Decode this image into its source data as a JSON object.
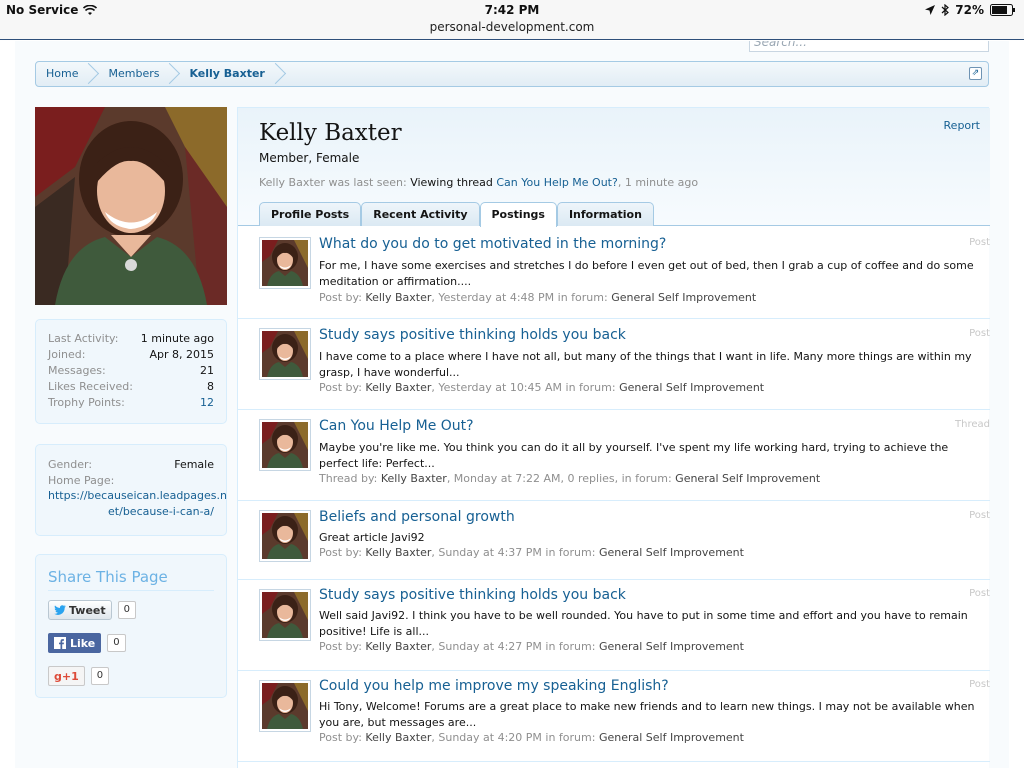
{
  "status_bar": {
    "carrier": "No Service",
    "time": "7:42 PM",
    "url": "personal-development.com",
    "battery": "72%"
  },
  "search": {
    "placeholder": "Search..."
  },
  "breadcrumb": [
    {
      "label": "Home"
    },
    {
      "label": "Members"
    },
    {
      "label": "Kelly Baxter"
    }
  ],
  "sidebar": {
    "stats": [
      {
        "label": "Last Activity:",
        "value": "1 minute ago"
      },
      {
        "label": "Joined:",
        "value": "Apr 8, 2015"
      },
      {
        "label": "Messages:",
        "value": "21"
      },
      {
        "label": "Likes Received:",
        "value": "8"
      },
      {
        "label": "Trophy Points:",
        "value": "12"
      }
    ],
    "info": {
      "gender_label": "Gender:",
      "gender_value": "Female",
      "homepage_label": "Home Page:",
      "homepage_line1": "https://becauseican.leadpages.n",
      "homepage_line2": "et/because-i-can-a/"
    },
    "share": {
      "title": "Share This Page",
      "tweet_label": "Tweet",
      "tweet_count": "0",
      "like_label": "Like",
      "like_count": "0",
      "gplus_label": "+1",
      "gplus_count": "0"
    }
  },
  "profile": {
    "name": "Kelly Baxter",
    "user_title": "Member, Female",
    "report_label": "Report",
    "last_seen_prefix": "Kelly Baxter was last seen:",
    "last_seen_action": "Viewing thread",
    "last_seen_thread": "Can You Help Me Out?",
    "last_seen_time": ", 1 minute ago"
  },
  "tabs": [
    {
      "label": "Profile Posts",
      "active": false
    },
    {
      "label": "Recent Activity",
      "active": false
    },
    {
      "label": "Postings",
      "active": true
    },
    {
      "label": "Information",
      "active": false
    }
  ],
  "posts": [
    {
      "title": "What do you do to get motivated in the morning?",
      "type": "Post",
      "snippet": "For me, I have some exercises and stretches I do before I even get out of bed, then I grab a cup of coffee and do some meditation or affirmation....",
      "meta_prefix": "Post by:",
      "author": "Kelly Baxter",
      "meta_mid": ", Yesterday at 4:48 PM in forum:",
      "forum": "General Self Improvement"
    },
    {
      "title": "Study says positive thinking holds you back",
      "type": "Post",
      "snippet": "I have come to a place where I have not all, but many of the things that I want in life. Many more things are within my grasp, I have wonderful...",
      "meta_prefix": "Post by:",
      "author": "Kelly Baxter",
      "meta_mid": ", Yesterday at 10:45 AM in forum:",
      "forum": "General Self Improvement"
    },
    {
      "title": "Can You Help Me Out?",
      "type": "Thread",
      "snippet": "Maybe you're like me. You think you can do it all by yourself. I've spent my life working hard, trying to achieve the perfect life: Perfect...",
      "meta_prefix": "Thread by:",
      "author": "Kelly Baxter",
      "meta_mid": ", Monday at 7:22 AM, 0 replies, in forum:",
      "forum": "General Self Improvement"
    },
    {
      "title": "Beliefs and personal growth",
      "type": "Post",
      "snippet": "Great article Javi92",
      "meta_prefix": "Post by:",
      "author": "Kelly Baxter",
      "meta_mid": ", Sunday at 4:37 PM in forum:",
      "forum": "General Self Improvement"
    },
    {
      "title": "Study says positive thinking holds you back",
      "type": "Post",
      "snippet": "Well said Javi92. I think you have to be well rounded. You have to put in some time and effort and you have to remain positive! Life is all...",
      "meta_prefix": "Post by:",
      "author": "Kelly Baxter",
      "meta_mid": ", Sunday at 4:27 PM in forum:",
      "forum": "General Self Improvement"
    },
    {
      "title": "Could you help me improve my speaking English?",
      "type": "Post",
      "snippet": "Hi Tony, Welcome! Forums are a great place to make new friends and to learn new things. I may not be available when you are, but messages are...",
      "meta_prefix": "Post by:",
      "author": "Kelly Baxter",
      "meta_mid": ", Sunday at 4:20 PM in forum:",
      "forum": "General Self Improvement"
    }
  ]
}
